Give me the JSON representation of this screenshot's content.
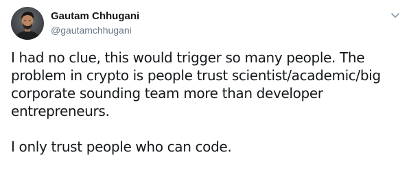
{
  "tweet": {
    "author": {
      "name": "Gautam Chhugani",
      "handle": "@gautamchhugani"
    },
    "menu_icon": "chevron-down-icon",
    "paragraphs": [
      "I had no clue, this would trigger so many people. The problem in crypto is people trust scientist/academic/big corporate sounding team more than developer entrepreneurs.",
      "I only trust people who can code."
    ]
  },
  "colors": {
    "text": "#14171a",
    "secondary_text": "#657786",
    "background": "#ffffff"
  }
}
